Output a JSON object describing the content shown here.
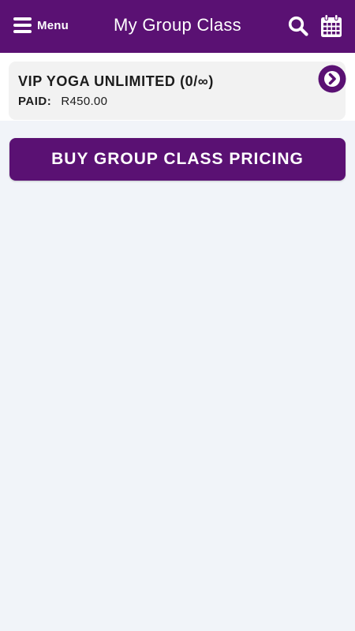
{
  "header": {
    "menu_label": "Menu",
    "title": "My Group Class",
    "icons": {
      "menu": "hamburger-menu-icon",
      "search": "search-icon",
      "calendar": "calendar-icon"
    }
  },
  "classes": [
    {
      "name": "VIP YOGA UNLIMITED (0/∞)",
      "paid_label": "PAID:",
      "paid_amount": "R450.00",
      "action_icon": "chevron-right-circle-icon"
    }
  ],
  "buy_button_label": "BUY GROUP CLASS PRICING",
  "colors": {
    "brand": "#5a1173",
    "background": "#f1f4f9",
    "card": "#f2f2f2",
    "text": "#1c1c1c"
  }
}
